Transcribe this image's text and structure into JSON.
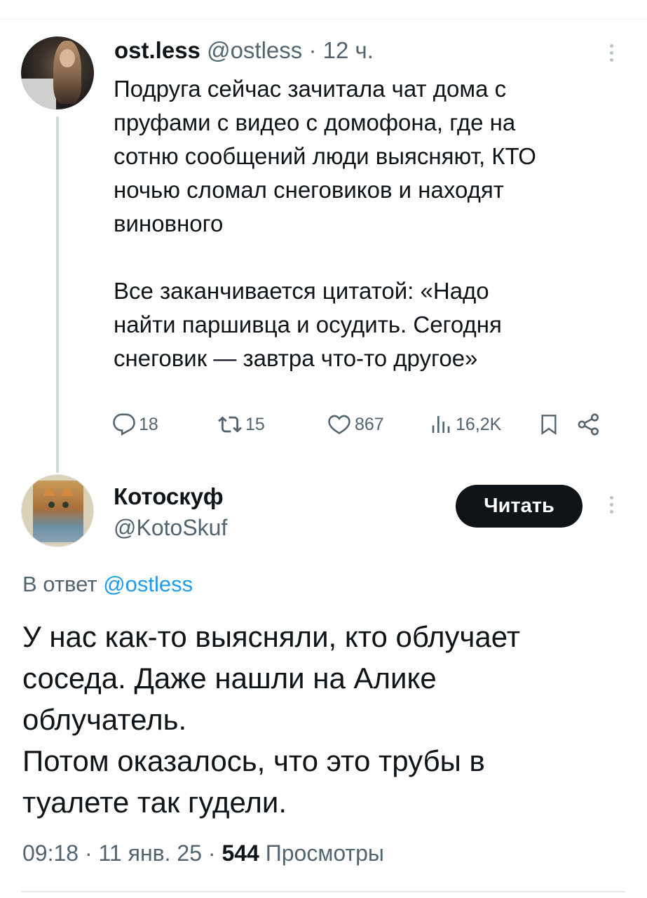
{
  "colors": {
    "text": "#0f1419",
    "muted": "#536471",
    "link": "#1d9bf0",
    "button_bg": "#0f1419",
    "button_text": "#ffffff",
    "thread_line": "#cfd9de"
  },
  "parent_tweet": {
    "author_name": "ost.less",
    "handle": "@ostless",
    "separator": "·",
    "time": "12 ч.",
    "text": "Подруга сейчас зачитала чат дома с\nпруфами с видео с домофона, где на\nсотню сообщений люди выясняют, КТО\nночью сломал снеговиков и находят\nвиновного\n\nВсе заканчивается цитатой: «Надо\nнайти паршивца и осудить. Сегодня\nснеговик — завтра что-то другое»",
    "stats": {
      "replies": "18",
      "reposts": "15",
      "likes": "867",
      "views": "16,2K"
    },
    "icons": [
      "reply-icon",
      "repost-icon",
      "like-icon",
      "views-icon",
      "bookmark-icon",
      "share-icon",
      "more-icon"
    ]
  },
  "reply_tweet": {
    "author_name": "Котоскуф",
    "handle": "@KotoSkuf",
    "follow_label": "Читать",
    "reply_to_prefix": "В ответ",
    "reply_to_handle": "@ostless",
    "text": "У нас как-то выясняли, кто облучает\nсоседа. Даже нашли на Алике\nоблучатель.\nПотом оказалось, что это трубы в\nтуалете так гудели.",
    "time": "09:18",
    "date": "11 янв. 25",
    "separator": "·",
    "views_count": "544",
    "views_label": "Просмотры"
  }
}
